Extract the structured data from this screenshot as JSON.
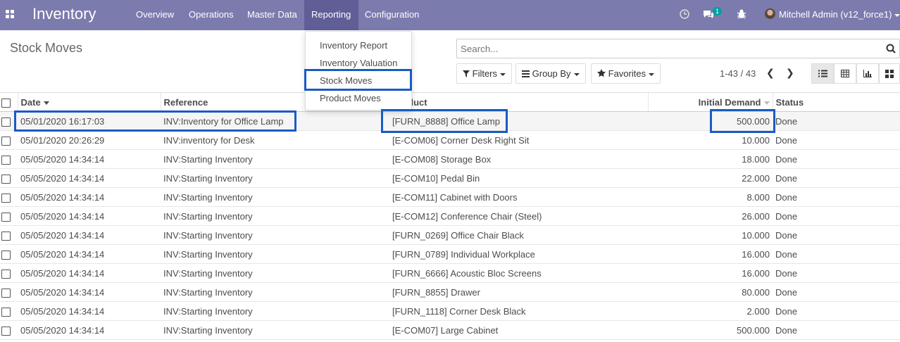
{
  "navbar": {
    "brand": "Inventory",
    "menu": [
      "Overview",
      "Operations",
      "Master Data",
      "Reporting",
      "Configuration"
    ],
    "messages_badge": "1",
    "user": "Mitchell Admin (v12_force1)"
  },
  "reporting_menu": [
    "Inventory Report",
    "Inventory Valuation",
    "Stock Moves",
    "Product Moves"
  ],
  "control_panel": {
    "title": "Stock Moves",
    "search_placeholder": "Search...",
    "filters": "Filters",
    "group_by": "Group By",
    "favorites": "Favorites",
    "pager": "1-43 / 43"
  },
  "table": {
    "columns": [
      "Date",
      "Reference",
      "Product",
      "Initial Demand",
      "Status"
    ],
    "rows": [
      {
        "date": "05/01/2020 16:17:03",
        "reference": "INV:Inventory for Office Lamp",
        "product": "[FURN_8888] Office Lamp",
        "demand": "500.000",
        "status": "Done"
      },
      {
        "date": "05/01/2020 20:26:29",
        "reference": "INV:inventory for Desk",
        "product": "[E-COM06] Corner Desk Right Sit",
        "demand": "10.000",
        "status": "Done"
      },
      {
        "date": "05/05/2020 14:34:14",
        "reference": "INV:Starting Inventory",
        "product": "[E-COM08] Storage Box",
        "demand": "18.000",
        "status": "Done"
      },
      {
        "date": "05/05/2020 14:34:14",
        "reference": "INV:Starting Inventory",
        "product": "[E-COM10] Pedal Bin",
        "demand": "22.000",
        "status": "Done"
      },
      {
        "date": "05/05/2020 14:34:14",
        "reference": "INV:Starting Inventory",
        "product": "[E-COM11] Cabinet with Doors",
        "demand": "8.000",
        "status": "Done"
      },
      {
        "date": "05/05/2020 14:34:14",
        "reference": "INV:Starting Inventory",
        "product": "[E-COM12] Conference Chair (Steel)",
        "demand": "26.000",
        "status": "Done"
      },
      {
        "date": "05/05/2020 14:34:14",
        "reference": "INV:Starting Inventory",
        "product": "[FURN_0269] Office Chair Black",
        "demand": "10.000",
        "status": "Done"
      },
      {
        "date": "05/05/2020 14:34:14",
        "reference": "INV:Starting Inventory",
        "product": "[FURN_0789] Individual Workplace",
        "demand": "16.000",
        "status": "Done"
      },
      {
        "date": "05/05/2020 14:34:14",
        "reference": "INV:Starting Inventory",
        "product": "[FURN_6666] Acoustic Bloc Screens",
        "demand": "16.000",
        "status": "Done"
      },
      {
        "date": "05/05/2020 14:34:14",
        "reference": "INV:Starting Inventory",
        "product": "[FURN_8855] Drawer",
        "demand": "80.000",
        "status": "Done"
      },
      {
        "date": "05/05/2020 14:34:14",
        "reference": "INV:Starting Inventory",
        "product": "[FURN_1118] Corner Desk Black",
        "demand": "2.000",
        "status": "Done"
      },
      {
        "date": "05/05/2020 14:34:14",
        "reference": "INV:Starting Inventory",
        "product": "[E-COM07] Large Cabinet",
        "demand": "500.000",
        "status": "Done"
      }
    ]
  },
  "colors": {
    "navbar": "#7c7bad",
    "navbar_active": "#5f5e97",
    "highlight_box": "#1a5bc4",
    "badge": "#00a09d"
  },
  "icons": [
    "apps-icon",
    "clock-icon",
    "chat-icon",
    "bug-icon",
    "search-icon",
    "star-icon",
    "list-view-icon",
    "pivot-view-icon",
    "graph-view-icon",
    "kanban-view-icon"
  ]
}
